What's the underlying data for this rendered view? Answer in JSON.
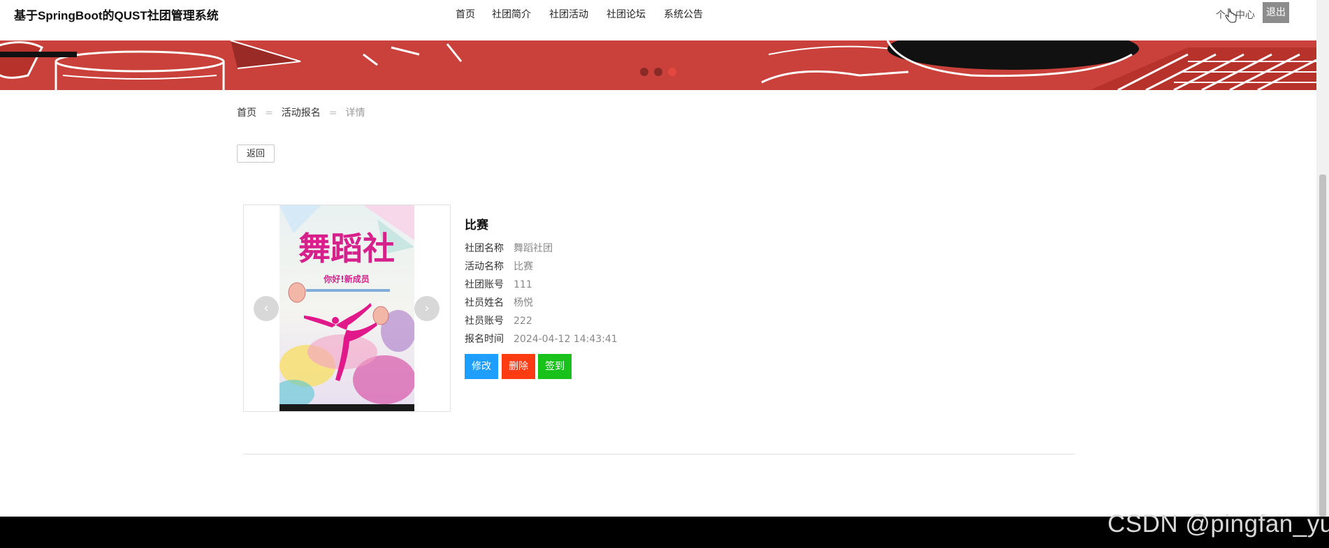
{
  "header": {
    "site_title": "基于SpringBoot的QUST社团管理系统",
    "nav": [
      "首页",
      "社团简介",
      "社团活动",
      "社团论坛",
      "系统公告"
    ],
    "user_center": "个人中心",
    "logout": "退出"
  },
  "banner": {
    "dots": 3,
    "active_dot": 3
  },
  "breadcrumb": {
    "home": "首页",
    "section": "活动报名",
    "current": "详情",
    "separator": "="
  },
  "back_label": "返回",
  "poster": {
    "title_text": "舞蹈社",
    "subtitle": "你好!新成员"
  },
  "detail": {
    "title": "比赛",
    "fields": [
      {
        "label": "社团名称",
        "value": "舞蹈社团"
      },
      {
        "label": "活动名称",
        "value": "比赛"
      },
      {
        "label": "社团账号",
        "value": "111"
      },
      {
        "label": "社员姓名",
        "value": "杨悦"
      },
      {
        "label": "社员账号",
        "value": "222"
      },
      {
        "label": "报名时间",
        "value": "2024-04-12 14:43:41"
      }
    ],
    "buttons": {
      "edit": "修改",
      "delete": "删除",
      "sign_in": "签到"
    }
  },
  "watermark": "CSDN @pingfan_yu",
  "colors": {
    "banner": "#c9413a",
    "edit": "#1e9fff",
    "delete": "#ff3b12",
    "sign_in": "#18c21a"
  }
}
